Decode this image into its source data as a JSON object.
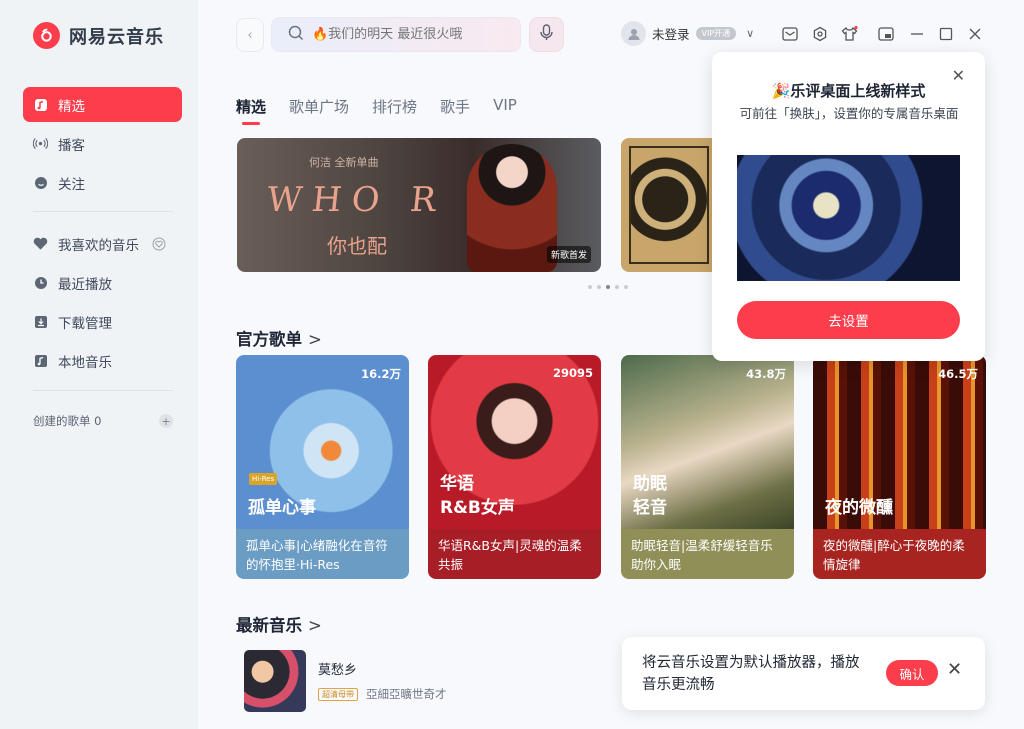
{
  "app": {
    "name": "网易云音乐"
  },
  "sidebar": {
    "items": [
      {
        "label": "精选"
      },
      {
        "label": "播客"
      },
      {
        "label": "关注"
      },
      {
        "label": "我喜欢的音乐"
      },
      {
        "label": "最近播放"
      },
      {
        "label": "下载管理"
      },
      {
        "label": "本地音乐"
      }
    ],
    "created_playlists": "创建的歌单 0"
  },
  "search": {
    "placeholder": "🔥我们的明天 最近很火哦"
  },
  "user": {
    "name": "未登录",
    "vip_badge": "VIP开通"
  },
  "tabs": [
    {
      "label": "精选"
    },
    {
      "label": "歌单广场"
    },
    {
      "label": "排行榜"
    },
    {
      "label": "歌手"
    },
    {
      "label": "VIP"
    }
  ],
  "banner": {
    "hint": "何洁  全新单曲",
    "title": "WHO R U",
    "subtitle": "你也配",
    "tag": "新歌首发"
  },
  "official_playlists": {
    "title": "官方歌单",
    "cards": [
      {
        "plays": "16.2万",
        "title": "孤单心事",
        "desc": "孤单心事|心绪融化在音符的怀抱里·Hi-Res",
        "color": "#6ea7d2"
      },
      {
        "plays": "29095",
        "title": "华语\nR&B女声",
        "desc": "华语R&B女声|灵魂的温柔共振",
        "color": "#c9262f"
      },
      {
        "plays": "43.8万",
        "title": "助眠\n轻音",
        "desc": "助眠轻音|温柔舒缓轻音乐助你入眠",
        "color": "#9a9a62"
      },
      {
        "plays": "46.5万",
        "title": "夜的微醺",
        "desc": "夜的微醺|醉心于夜晚的柔情旋律",
        "color": "#b22824"
      }
    ]
  },
  "new_music": {
    "title": "最新音乐",
    "items": [
      {
        "name": "莫愁乡",
        "quality": "超清母带",
        "artist": "亞細亞曠世奇才"
      }
    ]
  },
  "popup": {
    "title": "🎉乐评桌面上线新样式",
    "desc": "可前往「换肤」，设置你的专属音乐桌面",
    "button": "去设置"
  },
  "toast": {
    "message": "将云音乐设置为默认播放器，播放音乐更流畅",
    "confirm": "确认"
  },
  "colors": {
    "accent": "#fc3d4c"
  }
}
